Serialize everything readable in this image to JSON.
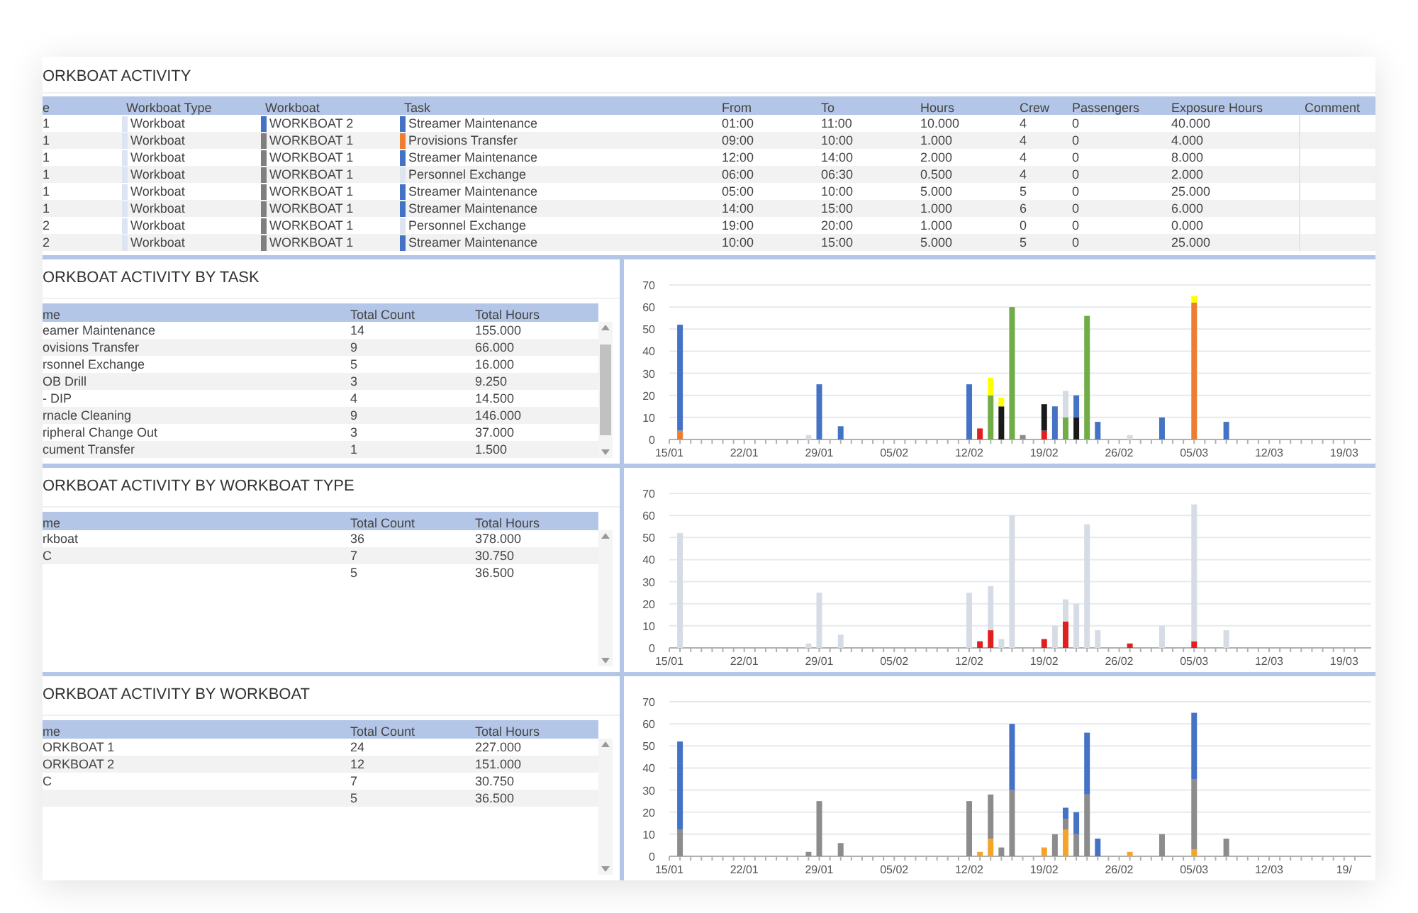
{
  "activity": {
    "title": "ORKBOAT ACTIVITY",
    "columns": [
      "e",
      "Workboat Type",
      "Workboat",
      "Task",
      "From",
      "To",
      "Hours",
      "Crew",
      "Passengers",
      "Exposure Hours",
      "Comment"
    ],
    "rows": [
      {
        "col1": "1",
        "type": {
          "text": "Workboat",
          "color": "#dde4f2"
        },
        "workboat": {
          "text": "WORKBOAT 2",
          "color": "#4472c4"
        },
        "task": {
          "text": "Streamer Maintenance",
          "color": "#4472c4"
        },
        "from": "01:00",
        "to": "11:00",
        "hours": "10.000",
        "crew": "4",
        "passengers": "0",
        "exposure": "40.000"
      },
      {
        "col1": "1",
        "type": {
          "text": "Workboat",
          "color": "#dde4f2"
        },
        "workboat": {
          "text": "WORKBOAT 1",
          "color": "#7f7f7f"
        },
        "task": {
          "text": "Provisions Transfer",
          "color": "#ed7d31"
        },
        "from": "09:00",
        "to": "10:00",
        "hours": "1.000",
        "crew": "4",
        "passengers": "0",
        "exposure": "4.000"
      },
      {
        "col1": "1",
        "type": {
          "text": "Workboat",
          "color": "#dde4f2"
        },
        "workboat": {
          "text": "WORKBOAT 1",
          "color": "#7f7f7f"
        },
        "task": {
          "text": "Streamer Maintenance",
          "color": "#4472c4"
        },
        "from": "12:00",
        "to": "14:00",
        "hours": "2.000",
        "crew": "4",
        "passengers": "0",
        "exposure": "8.000"
      },
      {
        "col1": "1",
        "type": {
          "text": "Workboat",
          "color": "#dde4f2"
        },
        "workboat": {
          "text": "WORKBOAT 1",
          "color": "#7f7f7f"
        },
        "task": {
          "text": "Personnel Exchange",
          "color": "#dde4f2"
        },
        "from": "06:00",
        "to": "06:30",
        "hours": "0.500",
        "crew": "4",
        "passengers": "0",
        "exposure": "2.000"
      },
      {
        "col1": "1",
        "type": {
          "text": "Workboat",
          "color": "#dde4f2"
        },
        "workboat": {
          "text": "WORKBOAT 1",
          "color": "#7f7f7f"
        },
        "task": {
          "text": "Streamer Maintenance",
          "color": "#4472c4"
        },
        "from": "05:00",
        "to": "10:00",
        "hours": "5.000",
        "crew": "5",
        "passengers": "0",
        "exposure": "25.000"
      },
      {
        "col1": "1",
        "type": {
          "text": "Workboat",
          "color": "#dde4f2"
        },
        "workboat": {
          "text": "WORKBOAT 1",
          "color": "#7f7f7f"
        },
        "task": {
          "text": "Streamer Maintenance",
          "color": "#4472c4"
        },
        "from": "14:00",
        "to": "15:00",
        "hours": "1.000",
        "crew": "6",
        "passengers": "0",
        "exposure": "6.000"
      },
      {
        "col1": "2",
        "type": {
          "text": "Workboat",
          "color": "#dde4f2"
        },
        "workboat": {
          "text": "WORKBOAT 1",
          "color": "#7f7f7f"
        },
        "task": {
          "text": "Personnel Exchange",
          "color": "#dde4f2"
        },
        "from": "19:00",
        "to": "20:00",
        "hours": "1.000",
        "crew": "0",
        "passengers": "0",
        "exposure": "0.000"
      },
      {
        "col1": "2",
        "type": {
          "text": "Workboat",
          "color": "#dde4f2"
        },
        "workboat": {
          "text": "WORKBOAT 1",
          "color": "#7f7f7f"
        },
        "task": {
          "text": "Streamer Maintenance",
          "color": "#4472c4"
        },
        "from": "10:00",
        "to": "15:00",
        "hours": "5.000",
        "crew": "5",
        "passengers": "0",
        "exposure": "25.000"
      }
    ]
  },
  "panels": [
    {
      "title": "ORKBOAT ACTIVITY BY TASK",
      "columns": [
        "me",
        "Total Count",
        "Total Hours"
      ],
      "rows": [
        [
          "eamer Maintenance",
          "14",
          "155.000"
        ],
        [
          "ovisions Transfer",
          "9",
          "66.000"
        ],
        [
          "rsonnel Exchange",
          "5",
          "16.000"
        ],
        [
          "OB Drill",
          "3",
          "9.250"
        ],
        [
          "- DIP",
          "4",
          "14.500"
        ],
        [
          "rnacle Cleaning",
          "9",
          "146.000"
        ],
        [
          "ripheral Change Out",
          "3",
          "37.000"
        ],
        [
          "cument Transfer",
          "1",
          "1.500"
        ]
      ],
      "chart_data": {
        "type": "bar",
        "stacked": true,
        "grid": true,
        "ylim": [
          0,
          70
        ],
        "yticks": [
          0,
          10,
          20,
          30,
          40,
          50,
          60,
          70
        ],
        "categories": [
          "15/01",
          null,
          null,
          null,
          null,
          null,
          null,
          "22/01",
          null,
          null,
          null,
          null,
          null,
          null,
          "29/01",
          null,
          null,
          null,
          null,
          null,
          null,
          "05/02",
          null,
          null,
          null,
          null,
          null,
          null,
          "12/02",
          null,
          null,
          null,
          null,
          null,
          null,
          "19/02",
          null,
          null,
          null,
          null,
          null,
          null,
          "26/02",
          null,
          null,
          null,
          null,
          null,
          null,
          "05/03",
          null,
          null,
          null,
          null,
          null,
          null,
          "12/03",
          null,
          null,
          null,
          null,
          null,
          null,
          "19/03",
          null
        ],
        "series": [
          {
            "color": "#ed7d31",
            "values": [
              null,
              4,
              null,
              null,
              null,
              null,
              null,
              null,
              null,
              null,
              null,
              null,
              null,
              null,
              null,
              null,
              null,
              null,
              null,
              null,
              null,
              null,
              null,
              null,
              null,
              null,
              null,
              null,
              null,
              null,
              null,
              null,
              null,
              null,
              null,
              null,
              null,
              null,
              null,
              null,
              null,
              null,
              null,
              null,
              null,
              null,
              null,
              null,
              null,
              62,
              null,
              null,
              null,
              null,
              null,
              null,
              null,
              null,
              null,
              null,
              null,
              null,
              null,
              null,
              null
            ]
          },
          {
            "color": "#e02020",
            "values": [
              null,
              null,
              null,
              null,
              null,
              null,
              null,
              null,
              null,
              null,
              null,
              null,
              null,
              null,
              null,
              null,
              null,
              null,
              null,
              null,
              null,
              null,
              null,
              null,
              null,
              null,
              null,
              null,
              null,
              5,
              null,
              null,
              null,
              null,
              null,
              4,
              null,
              null,
              null,
              null,
              null,
              null,
              null,
              null,
              null,
              null,
              null,
              null,
              null,
              null,
              null,
              null,
              null,
              null,
              null,
              null,
              null,
              null,
              null,
              null,
              null,
              null,
              null,
              null,
              null
            ]
          },
          {
            "color": "#70ad47",
            "values": [
              null,
              null,
              null,
              null,
              null,
              null,
              null,
              null,
              null,
              null,
              null,
              null,
              null,
              null,
              null,
              null,
              null,
              null,
              null,
              null,
              null,
              null,
              null,
              null,
              null,
              null,
              null,
              null,
              null,
              null,
              20,
              null,
              60,
              null,
              null,
              null,
              null,
              10,
              null,
              56,
              null,
              null,
              null,
              null,
              null,
              null,
              null,
              null,
              null,
              null,
              null,
              null,
              null,
              null,
              null,
              null,
              null,
              null,
              null,
              null,
              null,
              null,
              null,
              null,
              null
            ]
          },
          {
            "color": "#1a1a1a",
            "values": [
              null,
              null,
              null,
              null,
              null,
              null,
              null,
              null,
              null,
              null,
              null,
              null,
              null,
              null,
              null,
              null,
              null,
              null,
              null,
              null,
              null,
              null,
              null,
              null,
              null,
              null,
              null,
              null,
              null,
              null,
              null,
              15,
              null,
              null,
              null,
              12,
              null,
              null,
              10,
              null,
              null,
              null,
              null,
              null,
              null,
              null,
              null,
              null,
              null,
              null,
              null,
              null,
              null,
              null,
              null,
              null,
              null,
              null,
              null,
              null,
              null,
              null,
              null,
              null,
              null
            ]
          },
          {
            "color": "#8c8c8c",
            "values": [
              null,
              null,
              null,
              null,
              null,
              null,
              null,
              null,
              null,
              null,
              null,
              null,
              null,
              null,
              null,
              null,
              null,
              null,
              null,
              null,
              null,
              null,
              null,
              null,
              null,
              null,
              null,
              null,
              null,
              null,
              null,
              null,
              null,
              2,
              null,
              null,
              null,
              null,
              null,
              null,
              null,
              null,
              null,
              null,
              null,
              null,
              null,
              null,
              null,
              null,
              null,
              null,
              null,
              null,
              null,
              null,
              null,
              null,
              null,
              null,
              null,
              null,
              null,
              null,
              null
            ]
          },
          {
            "color": "#4472c4",
            "values": [
              null,
              48,
              null,
              null,
              null,
              null,
              null,
              null,
              null,
              null,
              null,
              null,
              null,
              null,
              25,
              null,
              6,
              null,
              null,
              null,
              null,
              null,
              null,
              null,
              null,
              null,
              null,
              null,
              25,
              null,
              null,
              null,
              null,
              null,
              null,
              null,
              15,
              null,
              10,
              null,
              8,
              null,
              null,
              null,
              null,
              null,
              10,
              null,
              null,
              null,
              null,
              null,
              8,
              null,
              null,
              null,
              null,
              null,
              null,
              null,
              null,
              null,
              null,
              null,
              null
            ]
          },
          {
            "color": "#d6dce5",
            "values": [
              null,
              null,
              null,
              null,
              null,
              null,
              null,
              null,
              null,
              null,
              null,
              null,
              null,
              2,
              null,
              null,
              null,
              null,
              null,
              null,
              null,
              null,
              null,
              null,
              null,
              null,
              null,
              null,
              null,
              null,
              null,
              null,
              null,
              null,
              null,
              null,
              null,
              12,
              null,
              null,
              null,
              null,
              null,
              2,
              null,
              null,
              null,
              null,
              null,
              null,
              null,
              null,
              null,
              null,
              null,
              null,
              null,
              null,
              null,
              null,
              null,
              null,
              null,
              null,
              null
            ]
          },
          {
            "color": "#ffff00",
            "values": [
              null,
              null,
              null,
              null,
              null,
              null,
              null,
              null,
              null,
              null,
              null,
              null,
              null,
              null,
              null,
              null,
              null,
              null,
              null,
              null,
              null,
              null,
              null,
              null,
              null,
              null,
              null,
              null,
              null,
              null,
              8,
              4,
              null,
              null,
              null,
              null,
              null,
              null,
              null,
              null,
              null,
              null,
              null,
              null,
              null,
              null,
              null,
              null,
              null,
              3,
              null,
              null,
              null,
              null,
              null,
              null,
              null,
              null,
              null,
              null,
              null,
              null,
              null,
              null,
              null
            ]
          }
        ]
      }
    },
    {
      "title": "ORKBOAT ACTIVITY BY WORKBOAT TYPE",
      "columns": [
        "me",
        "Total Count",
        "Total Hours"
      ],
      "rows": [
        [
          "rkboat",
          "36",
          "378.000"
        ],
        [
          "C",
          "7",
          "30.750"
        ],
        [
          "",
          "5",
          "36.500"
        ]
      ],
      "chart_data": {
        "type": "bar",
        "stacked": true,
        "grid": true,
        "ylim": [
          0,
          70
        ],
        "yticks": [
          0,
          10,
          20,
          30,
          40,
          50,
          60,
          70
        ],
        "categories": [
          "15/01",
          null,
          null,
          null,
          null,
          null,
          null,
          "22/01",
          null,
          null,
          null,
          null,
          null,
          null,
          "29/01",
          null,
          null,
          null,
          null,
          null,
          null,
          "05/02",
          null,
          null,
          null,
          null,
          null,
          null,
          "12/02",
          null,
          null,
          null,
          null,
          null,
          null,
          "19/02",
          null,
          null,
          null,
          null,
          null,
          null,
          "26/02",
          null,
          null,
          null,
          null,
          null,
          null,
          "05/03",
          null,
          null,
          null,
          null,
          null,
          null,
          "12/03",
          null,
          null,
          null,
          null,
          null,
          null,
          "19/03",
          null
        ],
        "series": [
          {
            "color": "#e02020",
            "values": [
              null,
              null,
              null,
              null,
              null,
              null,
              null,
              null,
              null,
              null,
              null,
              null,
              null,
              null,
              null,
              null,
              null,
              null,
              null,
              null,
              null,
              null,
              null,
              null,
              null,
              null,
              null,
              null,
              null,
              3,
              8,
              null,
              null,
              null,
              null,
              4,
              null,
              12,
              null,
              null,
              null,
              null,
              null,
              2,
              null,
              null,
              null,
              null,
              null,
              3,
              null,
              null,
              null,
              null,
              null,
              null,
              null,
              null,
              null,
              null,
              null,
              null,
              null,
              null,
              null
            ]
          },
          {
            "color": "#d6dce5",
            "values": [
              null,
              52,
              null,
              null,
              null,
              null,
              null,
              null,
              null,
              null,
              null,
              null,
              null,
              2,
              25,
              null,
              6,
              null,
              null,
              null,
              null,
              null,
              null,
              null,
              null,
              null,
              null,
              null,
              25,
              null,
              20,
              4,
              60,
              null,
              null,
              null,
              10,
              10,
              20,
              56,
              8,
              null,
              null,
              null,
              null,
              null,
              10,
              null,
              null,
              62,
              null,
              null,
              8,
              null,
              null,
              null,
              null,
              null,
              null,
              null,
              null,
              null,
              null,
              null,
              null
            ]
          }
        ]
      }
    },
    {
      "title": "ORKBOAT ACTIVITY BY WORKBOAT",
      "columns": [
        "me",
        "Total Count",
        "Total Hours"
      ],
      "rows": [
        [
          "ORKBOAT 1",
          "24",
          "227.000"
        ],
        [
          "ORKBOAT 2",
          "12",
          "151.000"
        ],
        [
          "C",
          "7",
          "30.750"
        ],
        [
          "",
          "5",
          "36.500"
        ]
      ],
      "chart_data": {
        "type": "bar",
        "stacked": true,
        "grid": true,
        "ylim": [
          0,
          70
        ],
        "yticks": [
          0,
          10,
          20,
          30,
          40,
          50,
          60,
          70
        ],
        "categories": [
          "15/01",
          null,
          null,
          null,
          null,
          null,
          null,
          "22/01",
          null,
          null,
          null,
          null,
          null,
          null,
          "29/01",
          null,
          null,
          null,
          null,
          null,
          null,
          "05/02",
          null,
          null,
          null,
          null,
          null,
          null,
          "12/02",
          null,
          null,
          null,
          null,
          null,
          null,
          "19/02",
          null,
          null,
          null,
          null,
          null,
          null,
          "26/02",
          null,
          null,
          null,
          null,
          null,
          null,
          "05/03",
          null,
          null,
          null,
          null,
          null,
          null,
          "12/03",
          null,
          null,
          null,
          null,
          null,
          null,
          "19/",
          null
        ],
        "series": [
          {
            "color": "#f4a428",
            "values": [
              null,
              null,
              null,
              null,
              null,
              null,
              null,
              null,
              null,
              null,
              null,
              null,
              null,
              null,
              null,
              null,
              null,
              null,
              null,
              null,
              null,
              null,
              null,
              null,
              null,
              null,
              null,
              null,
              null,
              2,
              8,
              null,
              null,
              null,
              null,
              4,
              null,
              12,
              null,
              null,
              null,
              null,
              null,
              2,
              null,
              null,
              null,
              null,
              null,
              3,
              null,
              null,
              null,
              null,
              null,
              null,
              null,
              null,
              null,
              null,
              null,
              null,
              null,
              null,
              null
            ]
          },
          {
            "color": "#8c8c8c",
            "values": [
              null,
              12,
              null,
              null,
              null,
              null,
              null,
              null,
              null,
              null,
              null,
              null,
              null,
              2,
              25,
              null,
              6,
              null,
              null,
              null,
              null,
              null,
              null,
              null,
              null,
              null,
              null,
              null,
              25,
              null,
              20,
              4,
              30,
              null,
              null,
              null,
              10,
              5,
              10,
              28,
              null,
              null,
              null,
              null,
              null,
              null,
              10,
              null,
              null,
              32,
              null,
              null,
              8,
              null,
              null,
              null,
              null,
              null,
              null,
              null,
              null,
              null,
              null,
              null,
              null
            ]
          },
          {
            "color": "#4472c4",
            "values": [
              null,
              40,
              null,
              null,
              null,
              null,
              null,
              null,
              null,
              null,
              null,
              null,
              null,
              null,
              null,
              null,
              null,
              null,
              null,
              null,
              null,
              null,
              null,
              null,
              null,
              null,
              null,
              null,
              null,
              null,
              null,
              null,
              30,
              null,
              null,
              null,
              null,
              5,
              10,
              28,
              8,
              null,
              null,
              null,
              null,
              null,
              null,
              null,
              null,
              30,
              null,
              null,
              null,
              null,
              null,
              null,
              null,
              null,
              null,
              null,
              null,
              null,
              null,
              null,
              null
            ]
          }
        ]
      }
    }
  ]
}
